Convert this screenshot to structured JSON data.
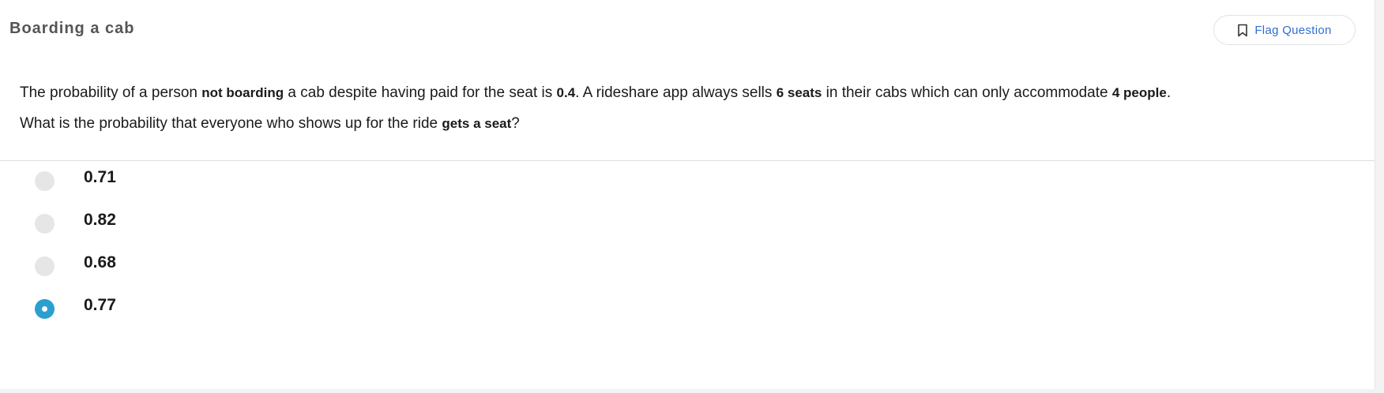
{
  "header": {
    "title": "Boarding a cab",
    "flag_button_label": "Flag Question",
    "flag_icon": "bookmark-icon"
  },
  "question": {
    "line1": {
      "t1": "The probability of a person ",
      "b1": "not boarding",
      "t2": " a cab despite having paid for the seat is ",
      "b2": "0.4",
      "t3": ". A rideshare app always sells ",
      "b3": "6 seats",
      "t4": " in their cabs which can only accommodate ",
      "b4": "4 people",
      "t5": "."
    },
    "line2": {
      "t1": "What is the probability that everyone who shows up for the ride ",
      "b1": "gets a seat",
      "t2": "?"
    }
  },
  "options": [
    {
      "label": "0.71",
      "selected": false
    },
    {
      "label": "0.82",
      "selected": false
    },
    {
      "label": "0.68",
      "selected": false
    },
    {
      "label": "0.77",
      "selected": true
    }
  ],
  "colors": {
    "accent": "#2a9fd0",
    "link": "#2f6fd0"
  }
}
